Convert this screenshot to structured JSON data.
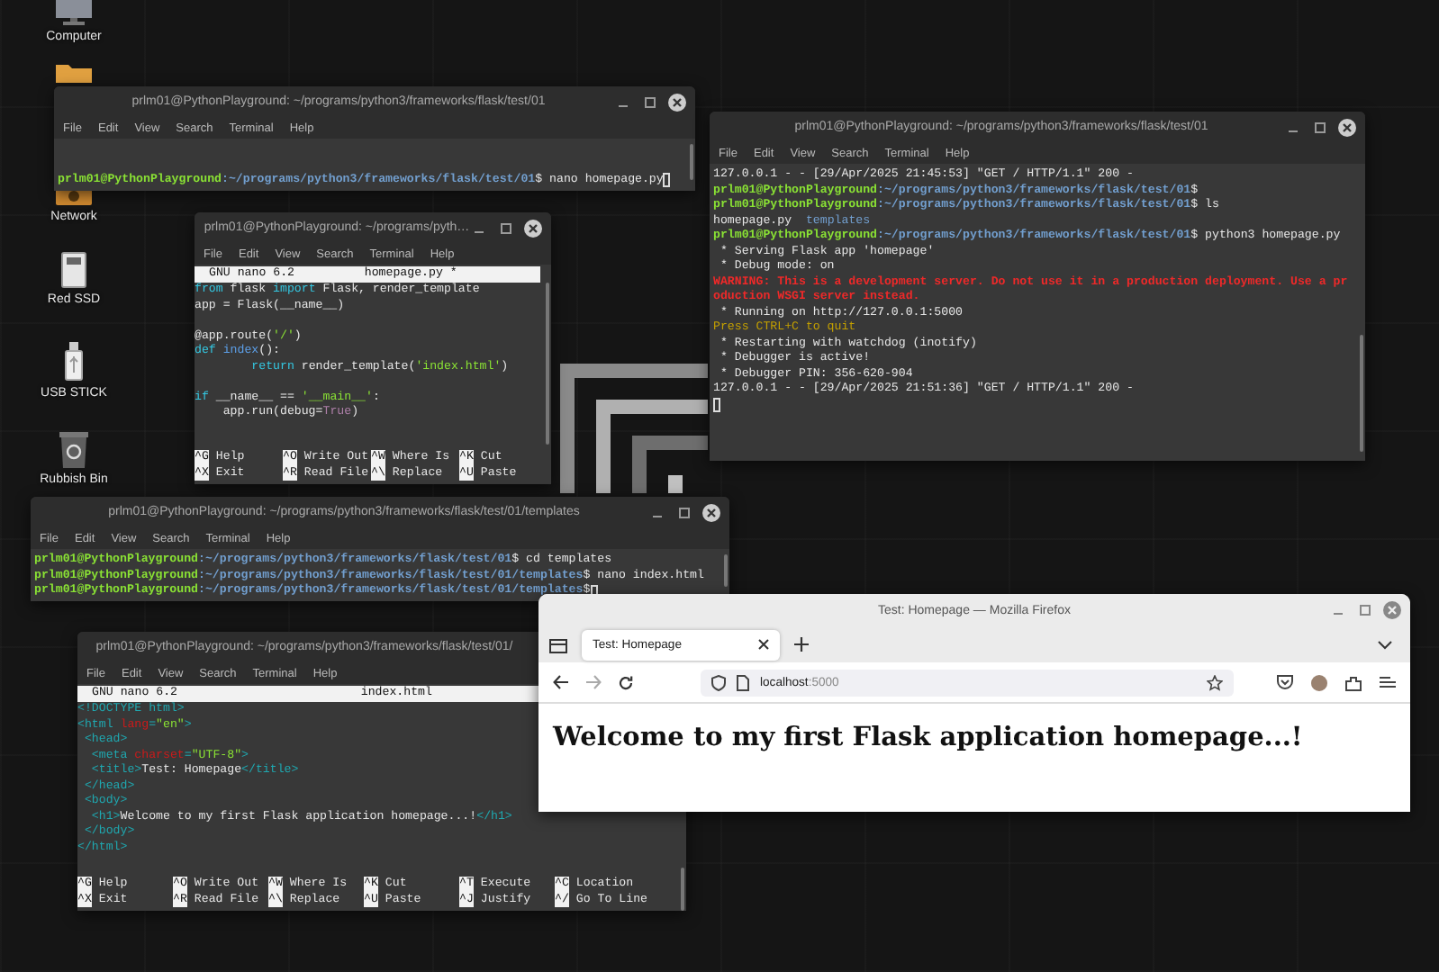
{
  "desktop_icons": [
    {
      "kind": "computer",
      "label": "Computer"
    },
    {
      "kind": "folder"
    },
    {
      "kind": "network",
      "label": "Network"
    },
    {
      "kind": "drive",
      "label": "Red SSD"
    },
    {
      "kind": "usb",
      "label": "USB STICK"
    },
    {
      "kind": "trash",
      "label": "Rubbish Bin"
    }
  ],
  "windows": [
    {
      "kind": "terminal",
      "title": "prlm01@PythonPlayground: ~/programs/python3/frameworks/flask/test/01",
      "menu": [
        "File",
        "Edit",
        "View",
        "Search",
        "Terminal",
        "Help"
      ],
      "blocks": [
        [
          {
            "segments": [
              {
                "text": "prlm01@PythonPlayground",
                "kind": "user"
              },
              {
                "text": ":~/programs/python3/frameworks/flask/test/01",
                "kind": "path"
              },
              {
                "text": "$ nano homepage.py",
                "kind": "plain"
              }
            ],
            "cursor": true
          }
        ]
      ]
    },
    {
      "kind": "nano",
      "title": "prlm01@PythonPlayground: ~/programs/pyth…",
      "menu": [
        "File",
        "Edit",
        "View",
        "Search",
        "Terminal",
        "Help"
      ],
      "version": "GNU nano 6.2",
      "file": "homepage.py *",
      "blocks": [
        [
          {
            "segments": [
              {
                "text": "from",
                "kind": "keyword"
              },
              {
                "text": " flask ",
                "kind": "plain"
              },
              {
                "text": "import",
                "kind": "keyword"
              },
              {
                "text": " Flask, render_template",
                "kind": "plain"
              }
            ]
          },
          {
            "segments": [
              {
                "text": "app = Flask(__name__)",
                "kind": "plain"
              }
            ]
          }
        ],
        [
          {
            "segments": [
              {
                "text": "@app.route(",
                "kind": "plain"
              },
              {
                "text": "'/'",
                "kind": "string"
              },
              {
                "text": ")",
                "kind": "plain"
              }
            ]
          },
          {
            "segments": [
              {
                "text": "def",
                "kind": "keyword"
              },
              {
                "text": " index",
                "kind": "func"
              },
              {
                "text": "():",
                "kind": "plain"
              }
            ]
          },
          {
            "segments": [
              {
                "text": "        return",
                "kind": "keyword"
              },
              {
                "text": " render_template(",
                "kind": "plain"
              },
              {
                "text": "'index.html'",
                "kind": "string"
              },
              {
                "text": ")",
                "kind": "plain"
              }
            ]
          }
        ],
        [
          {
            "segments": [
              {
                "text": "if",
                "kind": "keyword"
              },
              {
                "text": " __name__ == ",
                "kind": "plain"
              },
              {
                "text": "'__main__'",
                "kind": "string"
              },
              {
                "text": ":",
                "kind": "plain"
              }
            ]
          },
          {
            "segments": [
              {
                "text": "    app.run(debug=",
                "kind": "plain"
              },
              {
                "text": "True",
                "kind": "const"
              },
              {
                "text": ")",
                "kind": "plain"
              }
            ]
          }
        ]
      ],
      "shortcuts": [
        [
          {
            "key": "^G",
            "label": "Help"
          },
          {
            "key": "^O",
            "label": "Write Out"
          },
          {
            "key": "^W",
            "label": "Where Is"
          },
          {
            "key": "^K",
            "label": "Cut"
          }
        ],
        [
          {
            "key": "^X",
            "label": "Exit"
          },
          {
            "key": "^R",
            "label": "Read File"
          },
          {
            "key": "^\\",
            "label": "Replace"
          },
          {
            "key": "^U",
            "label": "Paste"
          }
        ]
      ]
    },
    {
      "kind": "terminal",
      "title": "prlm01@PythonPlayground: ~/programs/python3/frameworks/flask/test/01",
      "menu": [
        "File",
        "Edit",
        "View",
        "Search",
        "Terminal",
        "Help"
      ],
      "blocks": [
        [
          {
            "segments": [
              {
                "text": "127.0.0.1 - - [29/Apr/2025 21:45:53] \"GET / HTTP/1.1\" 200 -",
                "kind": "plain"
              }
            ]
          },
          {
            "segments": [
              {
                "text": "prlm01@PythonPlayground",
                "kind": "user"
              },
              {
                "text": ":~/programs/python3/frameworks/flask/test/01",
                "kind": "path"
              },
              {
                "text": "$",
                "kind": "plain"
              }
            ]
          },
          {
            "segments": [
              {
                "text": "prlm01@PythonPlayground",
                "kind": "user"
              },
              {
                "text": ":~/programs/python3/frameworks/flask/test/01",
                "kind": "path"
              },
              {
                "text": "$ ls",
                "kind": "plain"
              }
            ]
          },
          {
            "segments": [
              {
                "text": "homepage.py  ",
                "kind": "plain"
              },
              {
                "text": "templates",
                "kind": "dir"
              }
            ]
          },
          {
            "segments": [
              {
                "text": "prlm01@PythonPlayground",
                "kind": "user"
              },
              {
                "text": ":~/programs/python3/frameworks/flask/test/01",
                "kind": "path"
              },
              {
                "text": "$ python3 homepage.py",
                "kind": "plain"
              }
            ]
          },
          {
            "segments": [
              {
                "text": " * Serving Flask app 'homepage'",
                "kind": "plain"
              }
            ]
          },
          {
            "segments": [
              {
                "text": " * Debug mode: on",
                "kind": "plain"
              }
            ]
          },
          {
            "segments": [
              {
                "text": "WARNING: This is a development server. Do not use it in a production deployment. Use a pr",
                "kind": "error"
              }
            ]
          },
          {
            "segments": [
              {
                "text": "oduction WSGI server instead.",
                "kind": "error"
              }
            ]
          },
          {
            "segments": [
              {
                "text": " * Running on http://127.0.0.1:5000",
                "kind": "plain"
              }
            ]
          },
          {
            "segments": [
              {
                "text": "Press CTRL+C to quit",
                "kind": "warning"
              }
            ]
          },
          {
            "segments": [
              {
                "text": " * Restarting with watchdog (inotify)",
                "kind": "plain"
              }
            ]
          },
          {
            "segments": [
              {
                "text": " * Debugger is active!",
                "kind": "plain"
              }
            ]
          },
          {
            "segments": [
              {
                "text": " * Debugger PIN: 356-620-904",
                "kind": "plain"
              }
            ]
          },
          {
            "segments": [
              {
                "text": "127.0.0.1 - - [29/Apr/2025 21:51:36] \"GET / HTTP/1.1\" 200 -",
                "kind": "plain"
              }
            ]
          },
          {
            "cursor": true
          }
        ]
      ]
    },
    {
      "kind": "terminal",
      "title": "prlm01@PythonPlayground: ~/programs/python3/frameworks/flask/test/01/templates",
      "menu": [
        "File",
        "Edit",
        "View",
        "Search",
        "Terminal",
        "Help"
      ],
      "blocks": [
        [
          {
            "segments": [
              {
                "text": "prlm01@PythonPlayground",
                "kind": "user"
              },
              {
                "text": ":~/programs/python3/frameworks/flask/test/01",
                "kind": "path"
              },
              {
                "text": "$ cd templates",
                "kind": "plain"
              }
            ]
          },
          {
            "segments": [
              {
                "text": "prlm01@PythonPlayground",
                "kind": "user"
              },
              {
                "text": ":~/programs/python3/frameworks/flask/test/01/templates",
                "kind": "path"
              },
              {
                "text": "$ nano index.html",
                "kind": "plain"
              }
            ]
          },
          {
            "segments": [
              {
                "text": "prlm01@PythonPlayground",
                "kind": "user"
              },
              {
                "text": ":~/programs/python3/frameworks/flask/test/01/templates",
                "kind": "path"
              },
              {
                "text": "$",
                "kind": "plain"
              }
            ],
            "cursor": true
          }
        ]
      ]
    },
    {
      "kind": "nano",
      "title": "prlm01@PythonPlayground: ~/programs/python3/frameworks/flask/test/01/",
      "menu": [
        "File",
        "Edit",
        "View",
        "Search",
        "Terminal",
        "Help"
      ],
      "version": "GNU nano 6.2",
      "file": "index.html",
      "blocks": [
        [
          {
            "segments": [
              {
                "text": "<!DOCTYPE html>",
                "kind": "tag"
              }
            ]
          },
          {
            "segments": [
              {
                "text": "<html ",
                "kind": "tag"
              },
              {
                "text": "lang",
                "kind": "attr"
              },
              {
                "text": "=",
                "kind": "tag"
              },
              {
                "text": "\"en\"",
                "kind": "string"
              },
              {
                "text": ">",
                "kind": "tag"
              }
            ]
          },
          {
            "segments": [
              {
                "text": " <head>",
                "kind": "tag"
              }
            ]
          },
          {
            "segments": [
              {
                "text": "  <meta ",
                "kind": "tag"
              },
              {
                "text": "charset",
                "kind": "attr"
              },
              {
                "text": "=",
                "kind": "tag"
              },
              {
                "text": "\"UTF-8\"",
                "kind": "string"
              },
              {
                "text": ">",
                "kind": "tag"
              }
            ]
          },
          {
            "segments": [
              {
                "text": "  <title>",
                "kind": "tag"
              },
              {
                "text": "Test: Homepage",
                "kind": "plain"
              },
              {
                "text": "</title>",
                "kind": "tag"
              }
            ]
          },
          {
            "segments": [
              {
                "text": " </head>",
                "kind": "tag"
              }
            ]
          },
          {
            "segments": [
              {
                "text": " <body>",
                "kind": "tag"
              }
            ]
          },
          {
            "segments": [
              {
                "text": "  <h1>",
                "kind": "tag"
              },
              {
                "text": "Welcome to my first Flask application homepage...!",
                "kind": "plain"
              },
              {
                "text": "</h1>",
                "kind": "tag"
              }
            ]
          },
          {
            "segments": [
              {
                "text": " </body>",
                "kind": "tag"
              }
            ]
          },
          {
            "segments": [
              {
                "text": "</html>",
                "kind": "tag"
              }
            ]
          }
        ]
      ],
      "shortcuts": [
        [
          {
            "key": "^G",
            "label": "Help"
          },
          {
            "key": "^O",
            "label": "Write Out"
          },
          {
            "key": "^W",
            "label": "Where Is"
          },
          {
            "key": "^K",
            "label": "Cut"
          },
          {
            "key": "^T",
            "label": "Execute"
          },
          {
            "key": "^C",
            "label": "Location"
          }
        ],
        [
          {
            "key": "^X",
            "label": "Exit"
          },
          {
            "key": "^R",
            "label": "Read File"
          },
          {
            "key": "^\\",
            "label": "Replace"
          },
          {
            "key": "^U",
            "label": "Paste"
          },
          {
            "key": "^J",
            "label": "Justify"
          },
          {
            "key": "^/",
            "label": "Go To Line"
          }
        ]
      ]
    },
    {
      "kind": "browser",
      "title": "Test: Homepage — Mozilla Firefox",
      "tabs": [
        {
          "label": "Test: Homepage",
          "selected": true
        }
      ],
      "url": {
        "host": "localhost",
        "port": ":5000"
      },
      "heading": "Welcome to my first Flask application homepage...!"
    }
  ]
}
